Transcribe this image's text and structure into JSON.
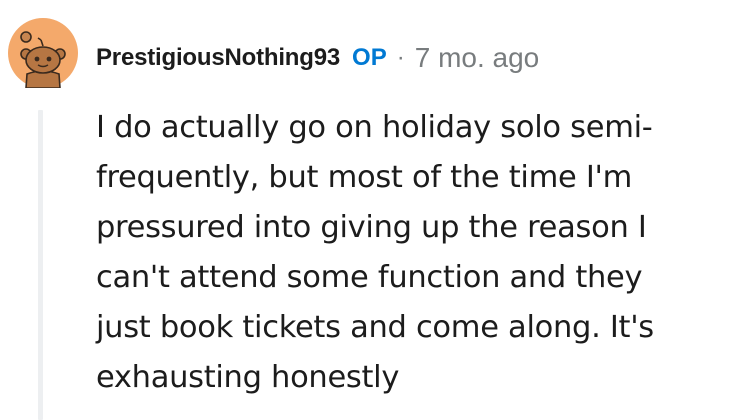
{
  "comment": {
    "author": "PrestigiousNothing93",
    "op_badge": "OP",
    "separator": "·",
    "timestamp": "7 mo. ago",
    "avatar_icon": "snoo-avatar-icon",
    "body_lines": [
      "I do actually go on holiday solo semi-",
      "frequently, but most of the time I'm",
      "pressured into giving up the reason I",
      "can't attend some function and they",
      "just book tickets and come along. It's",
      "exhausting honestly"
    ],
    "colors": {
      "avatar_bg": "#f4a96b",
      "op": "#0079d3",
      "meta": "#787c7e",
      "text": "#1c1c1c",
      "thread_line": "#edeff1"
    }
  }
}
